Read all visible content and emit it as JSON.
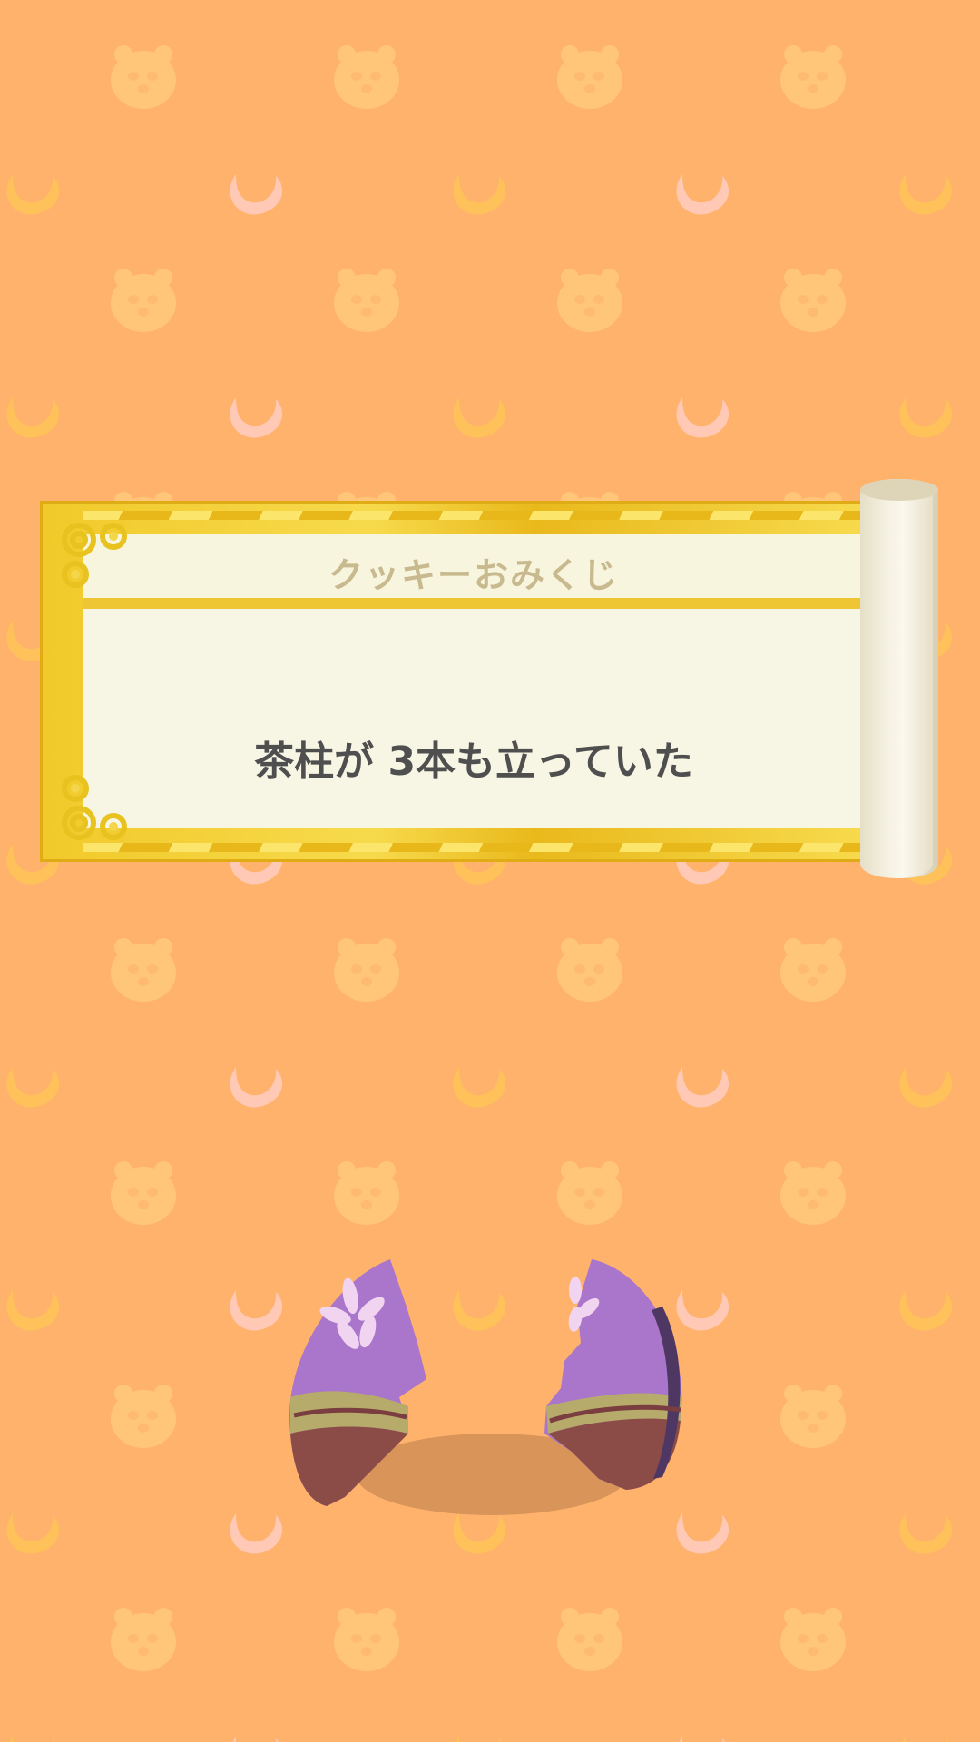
{
  "omikuji": {
    "title": "クッキーおみくじ",
    "fortune": "茶柱が 3本も立っていた"
  },
  "colors": {
    "background": "#FFB26B",
    "gold": "#F1C92A",
    "paper": "#F7F6E4",
    "title_text": "#C8B98E",
    "fortune_text": "#4F4F4F",
    "cookie_purple": "#A86FC9",
    "cookie_brown": "#8C4B45"
  },
  "icons": {
    "pattern_bear": "bear-face-icon",
    "pattern_cookie": "crescent-cookie-icon",
    "cookie": "broken-fortune-cookie-icon"
  }
}
